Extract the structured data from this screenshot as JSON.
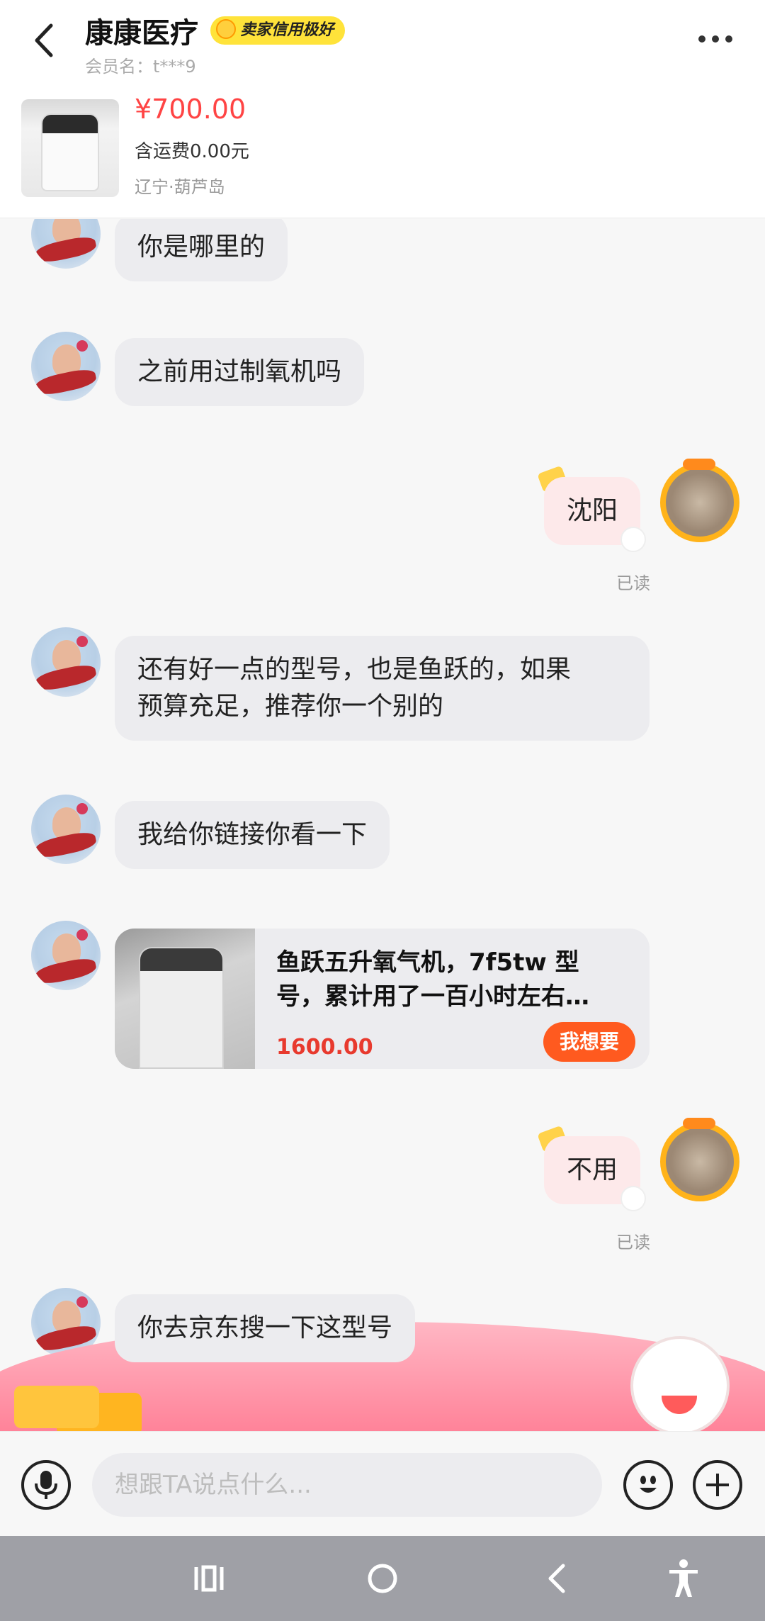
{
  "header": {
    "shop_name": "康康医疗",
    "credit_badge": "卖家信用极好",
    "member_label": "会员名：t***9"
  },
  "product": {
    "price": "¥700.00",
    "shipping": "含运费0.00元",
    "location": "辽宁·葫芦岛"
  },
  "messages": [
    {
      "from": "seller",
      "text": "你是哪里的"
    },
    {
      "from": "seller",
      "text": "之前用过制氧机吗"
    },
    {
      "from": "me",
      "text": "沈阳",
      "status": "已读"
    },
    {
      "from": "seller",
      "text_line1": "还有好一点的型号，也是鱼跃的，如果",
      "text_line2": "预算充足，推荐你一个别的"
    },
    {
      "from": "seller",
      "text": "我给你链接你看一下"
    },
    {
      "from": "me",
      "text": "不用",
      "status": "已读"
    },
    {
      "from": "seller",
      "text": "你去京东搜一下这型号"
    }
  ],
  "item_card": {
    "title_line1": "鱼跃五升氧气机，7f5tw 型",
    "title_line2": "号，累计用了一百小时左右…",
    "price": "1600.00",
    "button": "我想要"
  },
  "input": {
    "placeholder": "想跟TA说点什么..."
  },
  "icons": {
    "back": "chevron-left-icon",
    "more": "more-dots-icon",
    "voice": "microphone-icon",
    "emoji": "smiley-icon",
    "plus": "plus-icon"
  },
  "colors": {
    "price_red": "#ff4444",
    "badge_yellow": "#ffe33a",
    "want_orange": "#ff5a1f",
    "my_bubble": "#fde9ea"
  }
}
